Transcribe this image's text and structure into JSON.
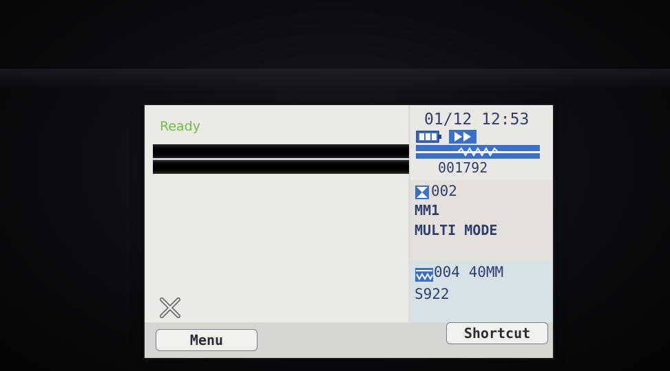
{
  "screen": {
    "status_text": "Ready",
    "datetime": "01/12 12:53",
    "splice_counter": "001792",
    "fiber_slot": "002",
    "fiber_type": "MM1",
    "fiber_mode": "MULTI MODE",
    "splice_program": "004 40MM",
    "splice_code": "S922"
  },
  "softkeys": {
    "menu": "Menu",
    "shortcut": "Shortcut"
  },
  "colors": {
    "status_green": "#6fbf3d",
    "text_navy": "#2f3e6e",
    "icon_blue": "#3a6fd0"
  },
  "icons": [
    "cancel-icon",
    "battery-icon",
    "play-icon",
    "arc-wave-icon",
    "fiber-mode-icon",
    "splice-program-icon"
  ]
}
